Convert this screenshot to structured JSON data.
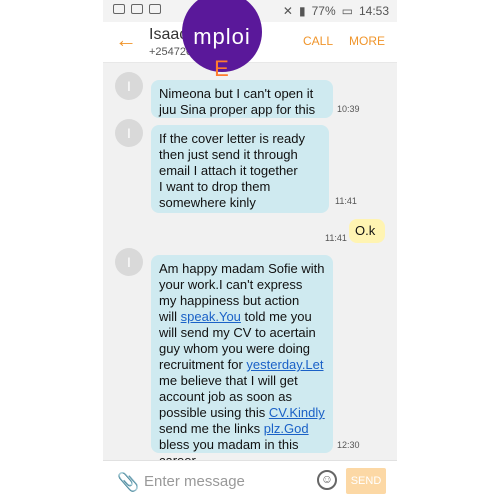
{
  "status": {
    "battery": "77%",
    "time": "14:53"
  },
  "header": {
    "name": "Isaac",
    "number": "+254720",
    "call_label": "CALL",
    "more_label": "MORE",
    "logo_text": "Emploi"
  },
  "messages": [
    {
      "direction": "incoming",
      "avatar": "I",
      "lines": [
        "Nimeona but I can't open it",
        "juu Sina proper app for this"
      ],
      "time": "10:39"
    },
    {
      "direction": "incoming",
      "avatar": "I",
      "lines": [
        "If the cover letter is ready",
        "then just send it through",
        "email I attach it together",
        "I want to drop them",
        "somewhere kinly"
      ],
      "time": "11:41"
    },
    {
      "direction": "outgoing",
      "text": "O.k",
      "time": "11:41"
    },
    {
      "direction": "incoming",
      "avatar": "I",
      "lines": [
        "Am happy madam Sofie with",
        "your work.I can't express",
        "my happiness but action",
        "will speak.You told me you",
        "will send my CV to acertain",
        "guy whom you were doing",
        "recruitment for yesterday.Let",
        "me believe that I will get",
        "account job as soon as",
        "possible using this CV.Kindly",
        "send me the links plz.God",
        "bless you madam in this",
        "career"
      ],
      "time": "12:30"
    }
  ],
  "input": {
    "placeholder": "Enter message",
    "send_label": "SEND"
  }
}
